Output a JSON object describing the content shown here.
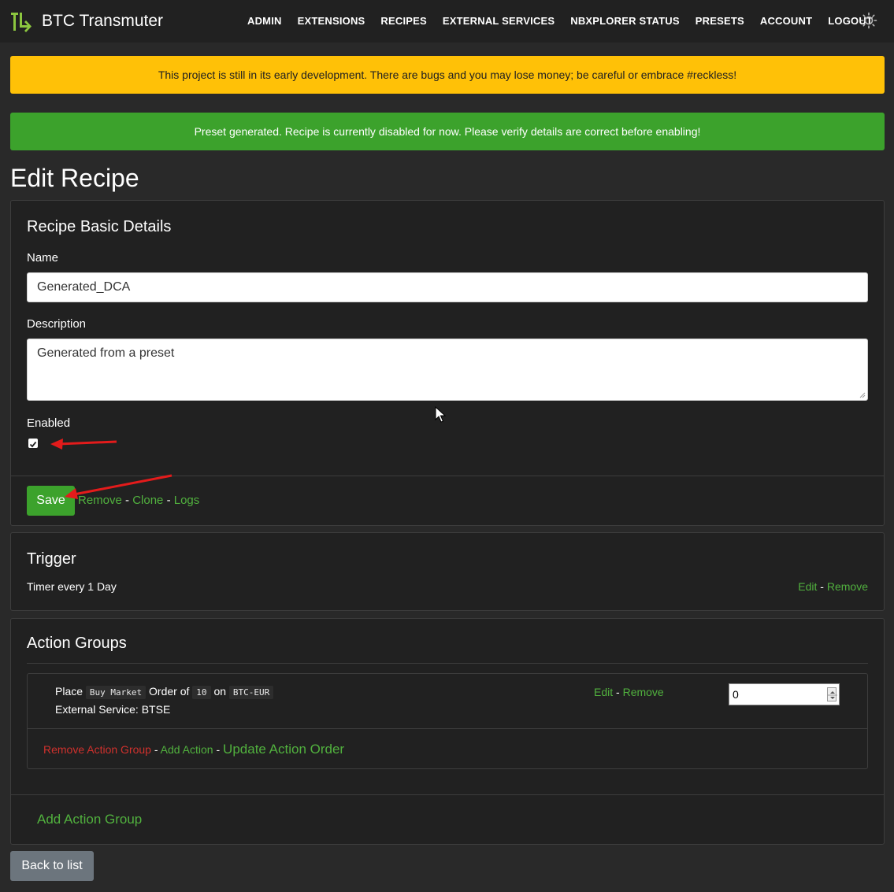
{
  "brand": {
    "name": "BTC Transmuter"
  },
  "nav": {
    "items": [
      {
        "label": "ADMIN"
      },
      {
        "label": "EXTENSIONS"
      },
      {
        "label": "RECIPES"
      },
      {
        "label": "EXTERNAL SERVICES"
      },
      {
        "label": "NBXPLORER STATUS"
      },
      {
        "label": "PRESETS"
      },
      {
        "label": "ACCOUNT"
      },
      {
        "label": "LOGOUT"
      }
    ],
    "theme_icon": "sun-icon"
  },
  "alerts": {
    "warning": "This project is still in its early development. There are bugs and you may lose money; be careful or embrace #reckless!",
    "success": "Preset generated. Recipe is currently disabled for now. Please verify details are correct before enabling!"
  },
  "page": {
    "title": "Edit Recipe"
  },
  "basic_details": {
    "title": "Recipe Basic Details",
    "name_label": "Name",
    "name_value": "Generated_DCA",
    "description_label": "Description",
    "description_value": "Generated from a preset",
    "enabled_label": "Enabled",
    "enabled_checked": true,
    "save_label": "Save",
    "remove_label": "Remove",
    "clone_label": "Clone",
    "logs_label": "Logs",
    "separator": "-"
  },
  "trigger": {
    "title": "Trigger",
    "description": "Timer every 1 Day",
    "edit_label": "Edit",
    "remove_label": "Remove"
  },
  "action_groups": {
    "title": "Action Groups",
    "groups": [
      {
        "actions": [
          {
            "text_place": "Place",
            "order_type": "Buy Market",
            "text_order_of": "Order of",
            "amount": "10",
            "text_on": "on",
            "pair": "BTC-EUR",
            "external_service": "External Service: BTSE",
            "edit_label": "Edit",
            "remove_label": "Remove",
            "order_value": "0"
          }
        ],
        "remove_group_label": "Remove Action Group",
        "add_action_label": "Add Action",
        "update_order_label": "Update Action Order"
      }
    ],
    "add_group_label": "Add Action Group"
  },
  "footer": {
    "back_label": "Back to list"
  },
  "colors": {
    "accent_green": "#51b13e",
    "danger_red": "#d0312d",
    "warning_yellow": "#ffc107",
    "success_green": "#3ca22c",
    "background": "#292929",
    "card_background": "#212121"
  }
}
